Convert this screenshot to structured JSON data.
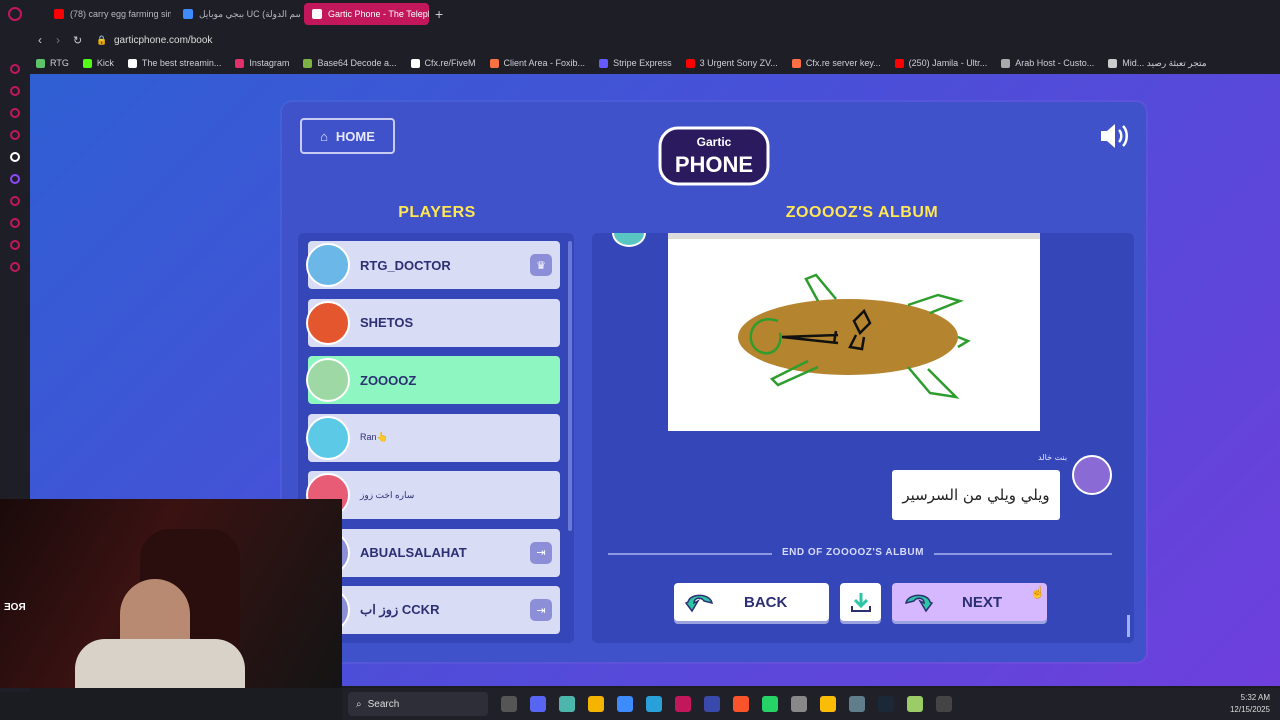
{
  "browser": {
    "tabs": [
      {
        "title": "(78) carry egg farming sim",
        "color": "#ff0000"
      },
      {
        "title": "ببجي موبايل UC (اسم الدولة",
        "color": "#3d8bfd"
      },
      {
        "title": "Gartic Phone - The Telepho",
        "color": "#ffffff",
        "active": true
      }
    ],
    "url": "garticphone.com/book",
    "bookmarks": [
      {
        "label": "RTG",
        "color": "#5ec46a"
      },
      {
        "label": "Kick",
        "color": "#53fc18"
      },
      {
        "label": "The best streamin...",
        "color": "#ffffff"
      },
      {
        "label": "Instagram",
        "color": "#e1306c"
      },
      {
        "label": "Base64 Decode a...",
        "color": "#7cb342"
      },
      {
        "label": "Cfx.re/FiveM",
        "color": "#ffffff"
      },
      {
        "label": "Client Area - Foxib...",
        "color": "#ff7043"
      },
      {
        "label": "Stripe Express",
        "color": "#635bff"
      },
      {
        "label": "3 Urgent Sony ZV...",
        "color": "#ff0000"
      },
      {
        "label": "Cfx.re server key...",
        "color": "#ff7043"
      },
      {
        "label": "(250) Jamila - Ultr...",
        "color": "#ff0000"
      },
      {
        "label": "Arab Host - Custo...",
        "color": "#aaaaaa"
      },
      {
        "label": "Mid... متجر تعبئة رصيد",
        "color": "#cccccc"
      }
    ]
  },
  "game": {
    "home_label": "HOME",
    "logo_top": "Gartic",
    "logo_bottom": "PHONE",
    "players_heading": "PLAYERS",
    "album_heading": "ZOOOOZ'S ALBUM",
    "players": [
      {
        "name": "RTG_DOCTOR",
        "avatar_color": "#6ab7e8",
        "badge": "crown-icon",
        "selected": false
      },
      {
        "name": "SHETOS",
        "avatar_color": "#e4572e",
        "selected": false
      },
      {
        "name": "ZOOOOZ",
        "avatar_color": "#9ed8a4",
        "selected": true
      },
      {
        "name": "Ran👆",
        "avatar_color": "#5cc9e6",
        "selected": false,
        "small": true
      },
      {
        "name": "ساره اخت زوز",
        "avatar_color": "#e85d75",
        "selected": false,
        "small": true
      },
      {
        "name": "ABUALSALAHAT",
        "avatar_color": "#8b8fd8",
        "badge": "exit-icon",
        "selected": false
      },
      {
        "name": "زوز اب CCKR",
        "avatar_color": "#8b8fd8",
        "badge": "exit-icon",
        "selected": false
      }
    ],
    "caption_author": "بنت خالد",
    "caption_text": "ويلي ويلي من السرسير",
    "end_text": "END OF ZOOOOZ'S ALBUM",
    "back_label": "BACK",
    "next_label": "NEXT"
  },
  "webcam": {
    "overlay_text": "ƎOЯ"
  },
  "taskbar": {
    "search_placeholder": "Search",
    "time": "5:32 AM",
    "date": "12/15/2025"
  }
}
